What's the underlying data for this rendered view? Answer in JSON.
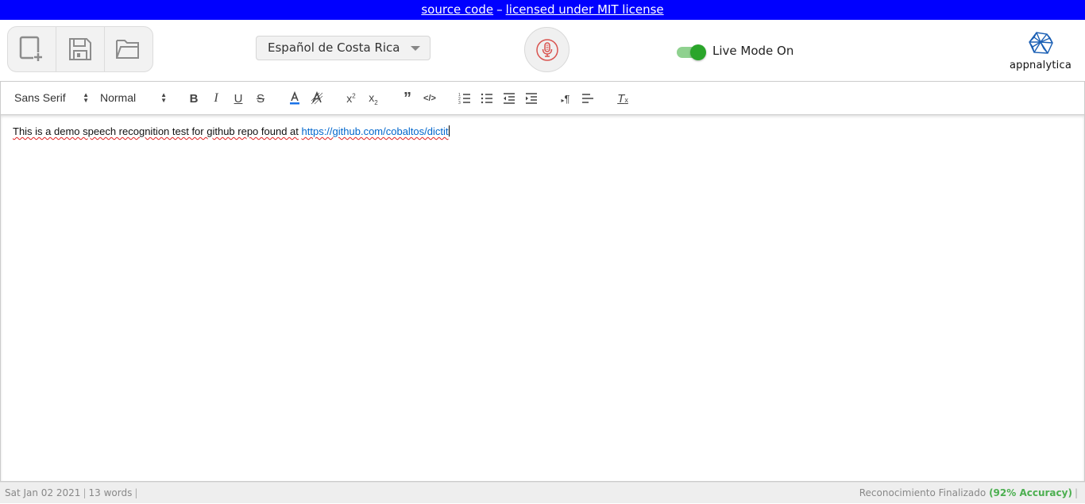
{
  "banner": {
    "source_link": "source code",
    "separator": "–",
    "license_link": "licensed under MIT license",
    "background": "#0000ff"
  },
  "file_toolbar": {
    "icons": [
      "new-document-icon",
      "save-icon",
      "open-folder-icon"
    ]
  },
  "language_select": {
    "selected": "Español de Costa Rica"
  },
  "mic_button": {
    "icon": "microphone-icon",
    "color": "#d9534f"
  },
  "live_mode": {
    "label": "Live Mode On",
    "on": true,
    "color": "#2aa52a"
  },
  "logo": {
    "text": "appnalytica",
    "color": "#1a5fb4"
  },
  "editor_toolbar": {
    "font_select": "Sans Serif",
    "size_select": "Normal",
    "buttons": [
      "bold",
      "italic",
      "underline",
      "strike",
      "text-color",
      "background-color",
      "superscript",
      "subscript",
      "blockquote",
      "code-block",
      "ordered-list",
      "bullet-list",
      "outdent",
      "indent",
      "text-direction",
      "align",
      "clear-formatting"
    ]
  },
  "editor": {
    "text": "This is a demo speech recognition test for github repo found at",
    "link": "https://github.com/cobaltos/dictit"
  },
  "status_bar": {
    "date": "Sat Jan 02 2021",
    "word_count": "13 words",
    "recognition_status": "Reconocimiento Finalizado",
    "accuracy": "(92% Accuracy)",
    "accuracy_color": "#4caf50"
  }
}
